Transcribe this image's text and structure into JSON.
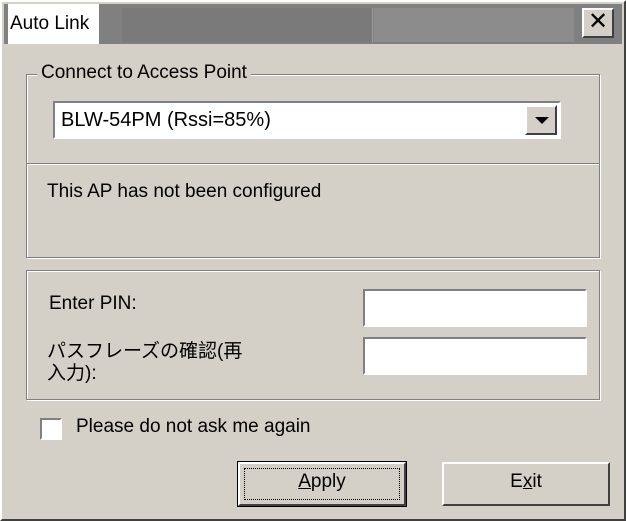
{
  "window": {
    "title": "Auto Link",
    "close_glyph": "✕"
  },
  "connect_group": {
    "legend": "Connect to Access Point",
    "selected_ap": "BLW-54PM (Rssi=85%)",
    "status_text": "This AP has not been configured"
  },
  "pin_group": {
    "pin_label": "Enter PIN:",
    "pin_value": "",
    "passphrase_label": "パスフレーズの確認(再入力):",
    "passphrase_value": ""
  },
  "checkbox": {
    "label": "Please do not ask me again",
    "checked": false
  },
  "buttons": {
    "apply_label": "Apply",
    "apply_mnemonic": "A",
    "exit_label": "Exit",
    "exit_mnemonic": "x"
  },
  "colors": {
    "dialog_bg": "#d4d0c8",
    "titlebar_bg": "#808080"
  }
}
